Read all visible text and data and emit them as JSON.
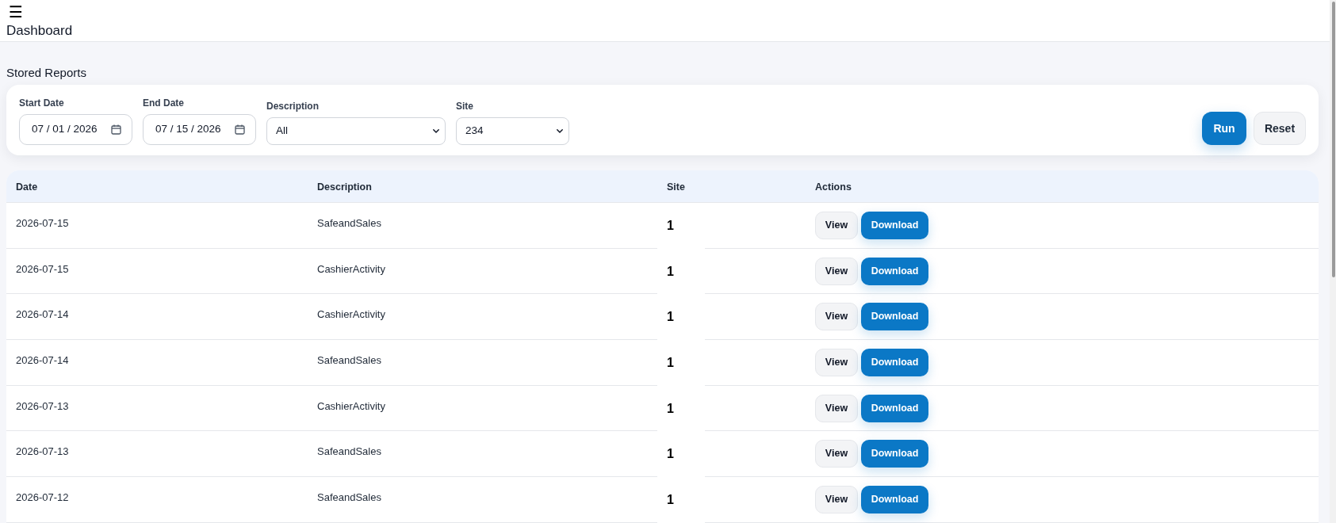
{
  "header": {
    "menu_icon": "☰",
    "title": "Dashboard"
  },
  "section_title": "Stored Reports",
  "filters": {
    "fields": [
      {
        "kind": "date",
        "label": "Start Date",
        "value": "07 / 01 / 2026"
      },
      {
        "kind": "date",
        "label": "End Date",
        "value": "07 / 15 / 2026"
      },
      {
        "kind": "select",
        "label": "Description",
        "value": "All"
      },
      {
        "kind": "select",
        "label": "Site",
        "value": "234"
      }
    ],
    "buttons": [
      {
        "kind": "primary",
        "label": "Run"
      },
      {
        "kind": "secondary",
        "label": "Reset"
      }
    ]
  },
  "table": {
    "columns": [
      "Date",
      "Description",
      "Site",
      "Actions"
    ],
    "rows": [
      {
        "date": "2026-07-15",
        "description": "SafeandSales",
        "site": "1",
        "actions": [
          {
            "kind": "secondary",
            "label": "View"
          },
          {
            "kind": "primary",
            "label": "Download"
          }
        ]
      },
      {
        "date": "2026-07-15",
        "description": "CashierActivity",
        "site": "1",
        "actions": [
          {
            "kind": "secondary",
            "label": "View"
          },
          {
            "kind": "primary",
            "label": "Download"
          }
        ]
      },
      {
        "date": "2026-07-14",
        "description": "CashierActivity",
        "site": "1",
        "actions": [
          {
            "kind": "secondary",
            "label": "View"
          },
          {
            "kind": "primary",
            "label": "Download"
          }
        ]
      },
      {
        "date": "2026-07-14",
        "description": "SafeandSales",
        "site": "1",
        "actions": [
          {
            "kind": "secondary",
            "label": "View"
          },
          {
            "kind": "primary",
            "label": "Download"
          }
        ]
      },
      {
        "date": "2026-07-13",
        "description": "CashierActivity",
        "site": "1",
        "actions": [
          {
            "kind": "secondary",
            "label": "View"
          },
          {
            "kind": "primary",
            "label": "Download"
          }
        ]
      },
      {
        "date": "2026-07-13",
        "description": "SafeandSales",
        "site": "1",
        "actions": [
          {
            "kind": "secondary",
            "label": "View"
          },
          {
            "kind": "primary",
            "label": "Download"
          }
        ]
      },
      {
        "date": "2026-07-12",
        "description": "SafeandSales",
        "site": "1",
        "actions": [
          {
            "kind": "secondary",
            "label": "View"
          },
          {
            "kind": "primary",
            "label": "Download"
          }
        ]
      }
    ]
  }
}
